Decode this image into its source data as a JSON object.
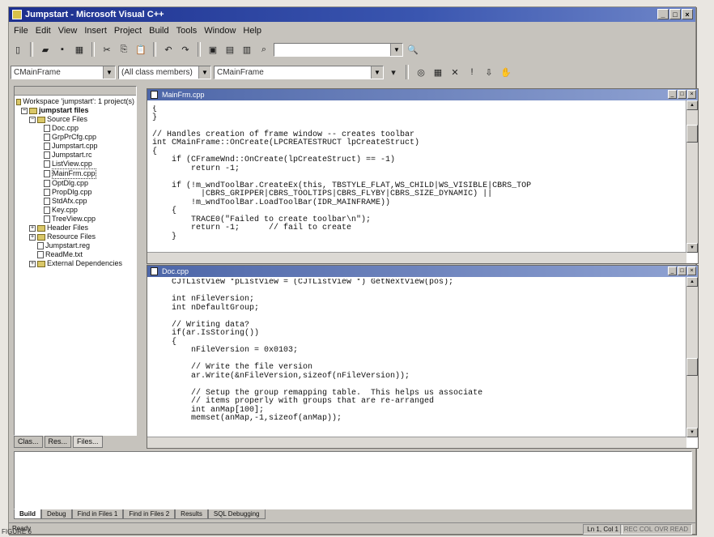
{
  "window": {
    "title": "Jumpstart - Microsoft Visual C++"
  },
  "menu": [
    "File",
    "Edit",
    "View",
    "Insert",
    "Project",
    "Build",
    "Tools",
    "Window",
    "Help"
  ],
  "toolbar2": {
    "class_combo": "CMainFrame",
    "members_combo": "(All class members)",
    "function_combo": "CMainFrame"
  },
  "workspace": {
    "root": "Workspace 'jumpstart': 1 project(s)",
    "project": "jumpstart files",
    "folders": {
      "source": "Source Files",
      "header": "Header Files",
      "resource": "Resource Files"
    },
    "files": [
      "Doc.cpp",
      "GrpPrCfg.cpp",
      "Jumpstart.cpp",
      "Jumpstart.rc",
      "ListView.cpp",
      "MainFrm.cpp",
      "OptDlg.cpp",
      "PropDlg.cpp",
      "StdAfx.cpp",
      "Key.cpp",
      "TreeView.cpp"
    ],
    "other_files": [
      "Jumpstart.reg",
      "ReadMe.txt"
    ],
    "external": "External Dependencies",
    "tabs": [
      "Clas...",
      "Res...",
      "Files..."
    ]
  },
  "editor1": {
    "title": "MainFrm.cpp",
    "code": "{\n}\n\n// Handles creation of frame window -- creates toolbar\nint CMainFrame::OnCreate(LPCREATESTRUCT lpCreateStruct)\n{\n    if (CFrameWnd::OnCreate(lpCreateStruct) == -1)\n        return -1;\n\n    if (!m_wndToolBar.CreateEx(this, TBSTYLE_FLAT,WS_CHILD|WS_VISIBLE|CBRS_TOP\n          |CBRS_GRIPPER|CBRS_TOOLTIPS|CBRS_FLYBY|CBRS_SIZE_DYNAMIC) ||\n        !m_wndToolBar.LoadToolBar(IDR_MAINFRAME))\n    {\n        TRACE0(\"Failed to create toolbar\\n\");\n        return -1;      // fail to create\n    }"
  },
  "editor2": {
    "title": "Doc.cpp",
    "code": "    CJTListView *pListView = (CJTListView *) GetNextView(pos);\n\n    int nFileVersion;\n    int nDefaultGroup;\n\n    // Writing data?\n    if(ar.IsStoring())\n    {\n        nFileVersion = 0x0103;\n\n        // Write the file version\n        ar.Write(&nFileVersion,sizeof(nFileVersion));\n\n        // Setup the group remapping table.  This helps us associate\n        // items properly with groups that are re-arranged\n        int anMap[100];\n        memset(anMap,-1,sizeof(anMap));"
  },
  "output_tabs": [
    "Build",
    "Debug",
    "Find in Files 1",
    "Find in Files 2",
    "Results",
    "SQL Debugging"
  ],
  "status": {
    "text": "Ready",
    "position": "Ln 1, Col 1",
    "indicators": "REC COL OVR READ"
  },
  "caption": "FIGURE 6"
}
